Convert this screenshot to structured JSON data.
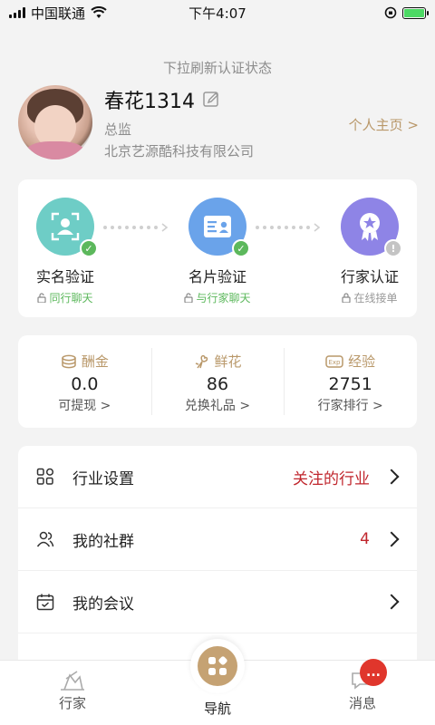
{
  "status_bar": {
    "carrier": "中国联通",
    "time": "下午4:07"
  },
  "pull_hint": "下拉刷新认证状态",
  "profile": {
    "name": "春花1314",
    "title": "总监",
    "company": "北京艺源酷科技有限公司",
    "home_link": "个人主页 >"
  },
  "verification": [
    {
      "label": "实名验证",
      "sub": "同行聊天",
      "status": "done",
      "color": "#6ecdc6",
      "icon": "user-id-icon"
    },
    {
      "label": "名片验证",
      "sub": "与行家聊天",
      "status": "done",
      "color": "#6aa3ea",
      "icon": "business-card-icon"
    },
    {
      "label": "行家认证",
      "sub": "在线接单",
      "status": "pending",
      "color": "#8e84e6",
      "icon": "award-badge-icon"
    }
  ],
  "stats": [
    {
      "label": "酬金",
      "value": "0.0",
      "link": "可提现 >",
      "icon": "coins-icon"
    },
    {
      "label": "鲜花",
      "value": "86",
      "link": "兑换礼品 >",
      "icon": "flower-icon"
    },
    {
      "label": "经验",
      "value": "2751",
      "link": "行家排行 >",
      "icon": "exp-icon"
    }
  ],
  "menu": [
    {
      "label": "行业设置",
      "value": "关注的行业",
      "icon": "grid-icon"
    },
    {
      "label": "我的社群",
      "value": "4",
      "icon": "community-icon"
    },
    {
      "label": "我的会议",
      "value": "",
      "icon": "calendar-icon"
    }
  ],
  "tabbar": {
    "left": "行家",
    "center": "导航",
    "right": "消息",
    "badge": "..."
  },
  "colors": {
    "accent_gold": "#b9986a",
    "alert_red": "#c0262d",
    "success_green": "#5cb85c"
  }
}
